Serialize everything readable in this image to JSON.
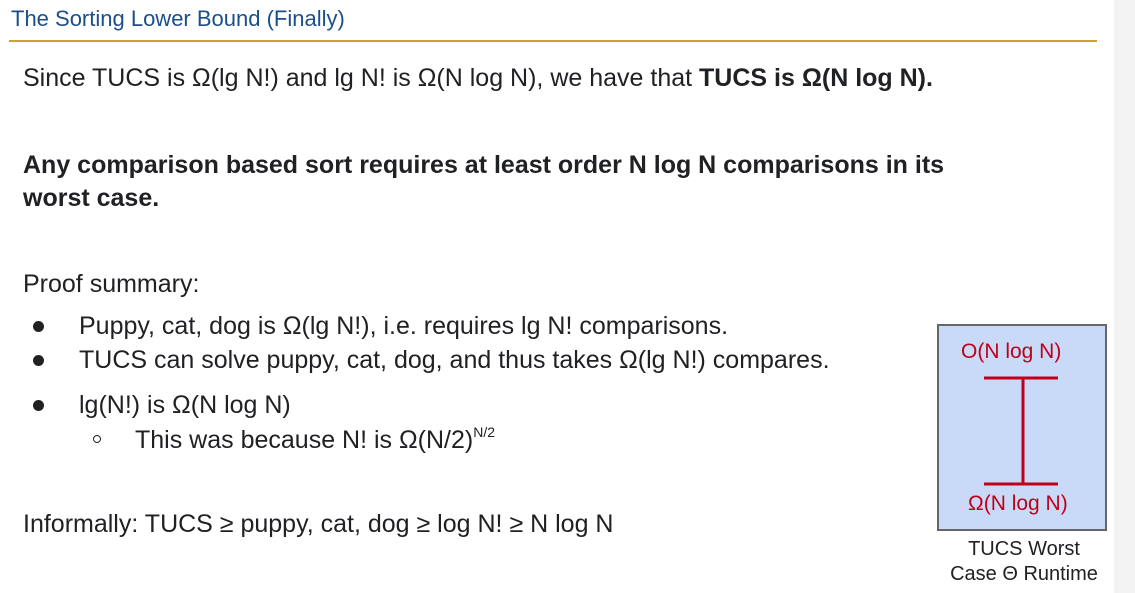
{
  "slide": {
    "title": "The Sorting Lower Bound (Finally)"
  },
  "intro": {
    "text": "Since TUCS is Ω(lg N!) and lg N! is Ω(N log N), we have that ",
    "bold": "TUCS is Ω(N log N)."
  },
  "claim": {
    "line1": "Any comparison based sort requires at least order N log N comparisons in its",
    "line2": "worst case."
  },
  "proof": {
    "heading": "Proof summary:",
    "bullets": [
      "Puppy, cat, dog is Ω(lg N!), i.e. requires lg N! comparisons.",
      "TUCS can solve puppy, cat, dog, and thus takes Ω(lg N!) compares.",
      "lg(N!) is Ω(N log N)"
    ],
    "sub_bullet": {
      "text": "This was because N! is Ω(N/2)",
      "superscript": "N/2"
    }
  },
  "informal": {
    "text": "Informally: TUCS ≥ puppy, cat, dog ≥ log N! ≥ N log N"
  },
  "diagram": {
    "upper_label": "O(N log N)",
    "lower_label": "Ω(N log N)",
    "caption_line1": "TUCS Worst",
    "caption_line2": "Case Θ Runtime",
    "colors": {
      "box_fill": "#c9daf8",
      "box_border": "#666666",
      "accent": "#c0001a"
    }
  },
  "theme": {
    "title_color": "#1b4f8a",
    "rule_color": "#c9a234"
  }
}
